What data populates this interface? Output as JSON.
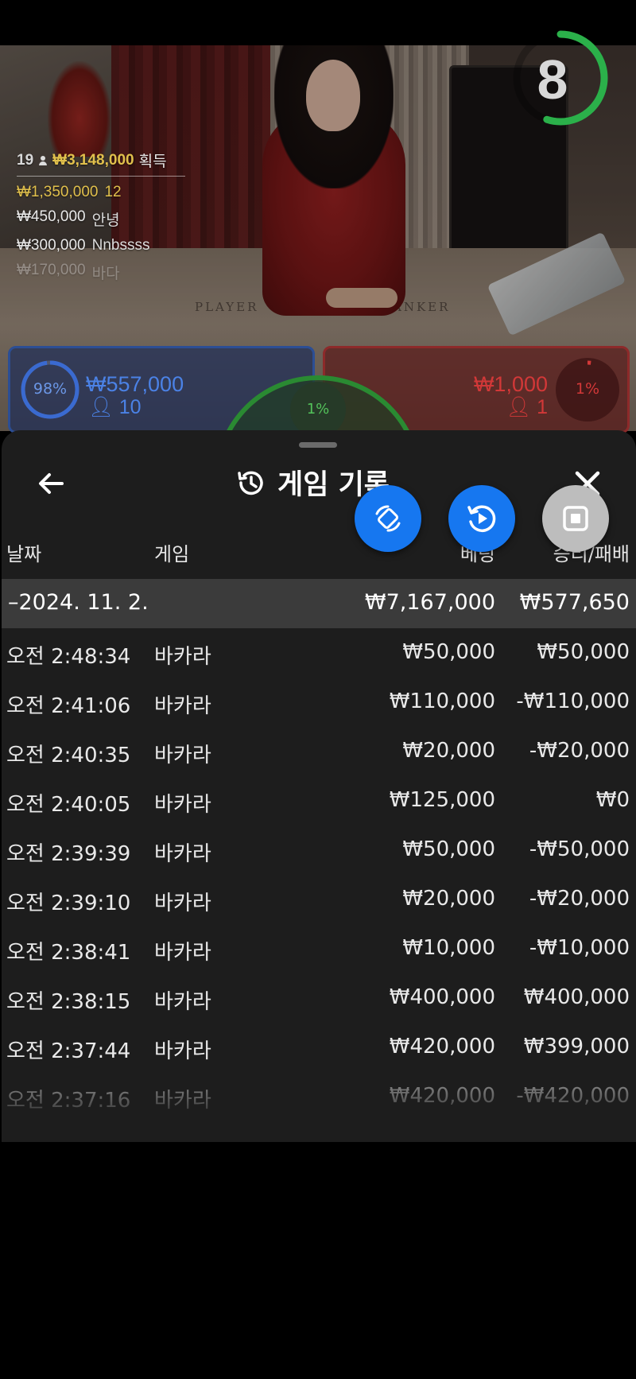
{
  "live_stream": {
    "timer_value": "8",
    "timer_fraction": 0.55,
    "table_labels": {
      "player": "PLAYER",
      "banker": "BANKER"
    },
    "winners": {
      "count": "19",
      "total": "₩3,148,000",
      "label": "획득",
      "list": [
        {
          "amount": "₩1,350,000",
          "name": "12"
        },
        {
          "amount": "₩450,000",
          "name": "안녕"
        },
        {
          "amount": "₩300,000",
          "name": "Nnbssss"
        },
        {
          "amount": "₩170,000",
          "name": "바다"
        }
      ]
    },
    "player_bet": {
      "percent": "98%",
      "percent_value": 0.98,
      "amount": "₩557,000",
      "players": "10",
      "color": "#3a6ad0"
    },
    "banker_bet": {
      "percent": "1%",
      "percent_value": 0.01,
      "amount": "₩1,000",
      "players": "1",
      "color": "#d03a3a"
    },
    "tie_bet": {
      "percent": "1%",
      "color": "#53c25a"
    }
  },
  "history": {
    "title": "게임 기록",
    "icons": {
      "back": "back-arrow-icon",
      "history": "history-icon",
      "close": "close-icon"
    },
    "columns": {
      "date": "날짜",
      "game": "게임",
      "bet": "베팅",
      "winloss": "승리/패배"
    },
    "date_group": {
      "date": "–2024. 11. 2.",
      "bet_total": "₩7,167,000",
      "winloss_total": "₩577,650"
    },
    "rows": [
      {
        "time": "오전 2:48:34",
        "game": "바카라",
        "bet": "₩50,000",
        "winloss": "₩50,000"
      },
      {
        "time": "오전 2:41:06",
        "game": "바카라",
        "bet": "₩110,000",
        "winloss": "-₩110,000"
      },
      {
        "time": "오전 2:40:35",
        "game": "바카라",
        "bet": "₩20,000",
        "winloss": "-₩20,000"
      },
      {
        "time": "오전 2:40:05",
        "game": "바카라",
        "bet": "₩125,000",
        "winloss": "₩0"
      },
      {
        "time": "오전 2:39:39",
        "game": "바카라",
        "bet": "₩50,000",
        "winloss": "-₩50,000"
      },
      {
        "time": "오전 2:39:10",
        "game": "바카라",
        "bet": "₩20,000",
        "winloss": "-₩20,000"
      },
      {
        "time": "오전 2:38:41",
        "game": "바카라",
        "bet": "₩10,000",
        "winloss": "-₩10,000"
      },
      {
        "time": "오전 2:38:15",
        "game": "바카라",
        "bet": "₩400,000",
        "winloss": "₩400,000"
      },
      {
        "time": "오전 2:37:44",
        "game": "바카라",
        "bet": "₩420,000",
        "winloss": "₩399,000"
      },
      {
        "time": "오전 2:37:16",
        "game": "바카라",
        "bet": "₩420,000",
        "winloss": "-₩420,000"
      }
    ]
  },
  "floating_buttons": [
    {
      "icon": "rotate-screen-icon",
      "color": "#1677f0"
    },
    {
      "icon": "replay-icon",
      "color": "#1677f0"
    },
    {
      "icon": "stop-icon",
      "color": "#bdbdbd"
    }
  ]
}
